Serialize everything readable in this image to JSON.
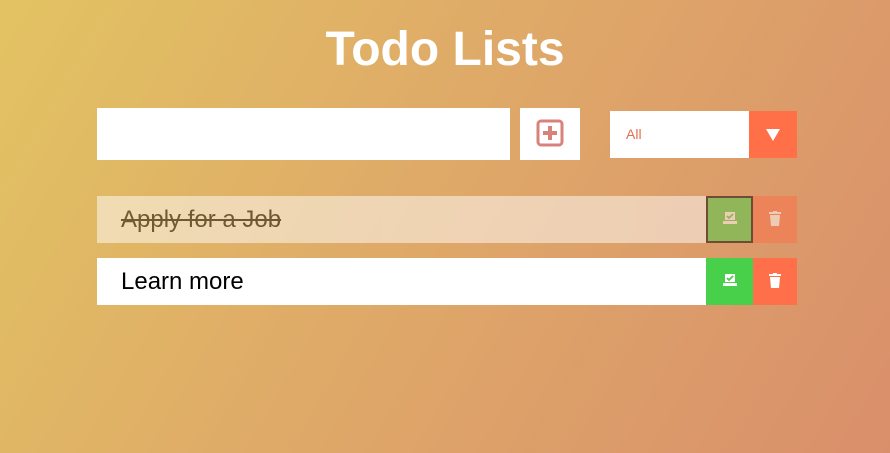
{
  "header": {
    "title": "Todo Lists"
  },
  "form": {
    "input_value": "",
    "input_placeholder": "",
    "add_icon": "plus-square-icon"
  },
  "filter": {
    "selected": "All",
    "arrow_icon": "triangle-down-icon"
  },
  "todos": [
    {
      "text": "Apply for a Job",
      "completed": true
    },
    {
      "text": "Learn more",
      "completed": false
    }
  ],
  "colors": {
    "background_start": "#e2c362",
    "background_end": "#d98f6b",
    "check": "#49d04a",
    "trash": "#ff6f49",
    "filter_arrow": "#ff7049",
    "add_icon": "#d9827a"
  },
  "icons": {
    "check": "check-box-icon",
    "trash": "trash-icon"
  }
}
